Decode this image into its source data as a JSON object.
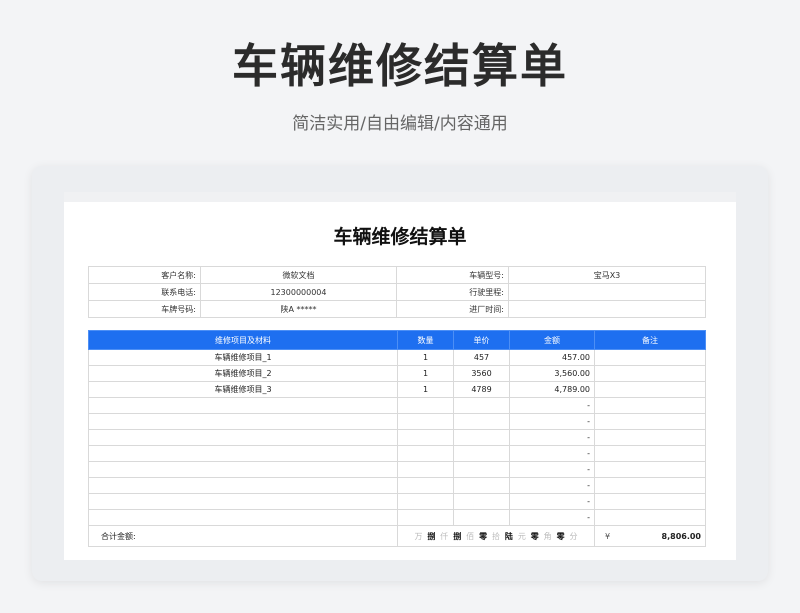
{
  "header": {
    "title": "车辆维修结算单",
    "subtitle": "简洁实用/自由编辑/内容通用"
  },
  "document": {
    "title": "车辆维修结算单",
    "info": {
      "customer_label": "客户名称:",
      "customer_value": "微软文档",
      "model_label": "车辆型号:",
      "model_value": "宝马X3",
      "phone_label": "联系电话:",
      "phone_value": "12300000004",
      "mileage_label": "行驶里程:",
      "mileage_value": "",
      "plate_label": "车牌号码:",
      "plate_value": "陕A *****",
      "entry_time_label": "进厂时间:",
      "entry_time_value": ""
    },
    "table": {
      "headers": [
        "维修项目及材料",
        "数量",
        "单价",
        "金额",
        "备注"
      ],
      "rows": [
        {
          "item": "车辆维修项目_1",
          "qty": "1",
          "price": "457",
          "amount": "457.00",
          "note": ""
        },
        {
          "item": "车辆维修项目_2",
          "qty": "1",
          "price": "3560",
          "amount": "3,560.00",
          "note": ""
        },
        {
          "item": "车辆维修项目_3",
          "qty": "1",
          "price": "4789",
          "amount": "4,789.00",
          "note": ""
        },
        {
          "item": "",
          "qty": "",
          "price": "",
          "amount": "-",
          "note": ""
        },
        {
          "item": "",
          "qty": "",
          "price": "",
          "amount": "-",
          "note": ""
        },
        {
          "item": "",
          "qty": "",
          "price": "",
          "amount": "-",
          "note": ""
        },
        {
          "item": "",
          "qty": "",
          "price": "",
          "amount": "-",
          "note": ""
        },
        {
          "item": "",
          "qty": "",
          "price": "",
          "amount": "-",
          "note": ""
        },
        {
          "item": "",
          "qty": "",
          "price": "",
          "amount": "-",
          "note": ""
        },
        {
          "item": "",
          "qty": "",
          "price": "",
          "amount": "-",
          "note": ""
        },
        {
          "item": "",
          "qty": "",
          "price": "",
          "amount": "-",
          "note": ""
        }
      ]
    },
    "total": {
      "label": "合计金额:",
      "chinese": [
        "万",
        "捌",
        "仟",
        "捌",
        "佰",
        "零",
        "拾",
        "陆",
        "元",
        "零",
        "角",
        "零",
        "分"
      ],
      "currency": "¥",
      "amount": "8,806.00"
    }
  },
  "colors": {
    "header_blue": "#1e6ff0",
    "page_bg": "#f3f4f6"
  }
}
